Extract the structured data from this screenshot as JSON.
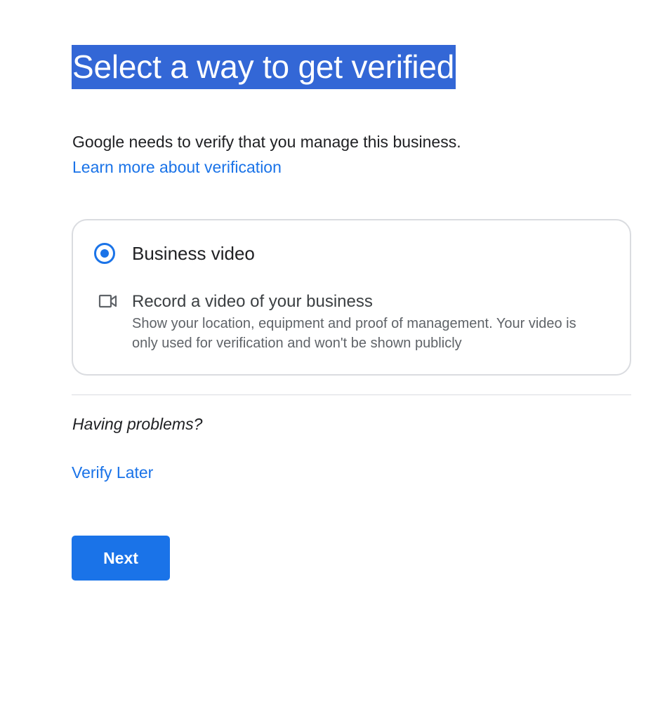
{
  "header": {
    "title": "Select a way to get verified"
  },
  "intro": {
    "text": "Google needs to verify that you manage this business.",
    "link_label": "Learn more about verification"
  },
  "option": {
    "selected": true,
    "title": "Business video",
    "icon": "videocam-icon",
    "subtitle": "Record a video of your business",
    "description": "Show your location, equipment and proof of management. Your video is only used for verification and won't be shown publicly"
  },
  "help": {
    "problems_label": "Having problems?",
    "verify_later_label": "Verify Later"
  },
  "actions": {
    "next_label": "Next"
  },
  "colors": {
    "accent": "#1a73e8",
    "title_highlight": "#3367d6",
    "border": "#dadce0",
    "text_primary": "#202124",
    "text_secondary": "#5f6368"
  }
}
